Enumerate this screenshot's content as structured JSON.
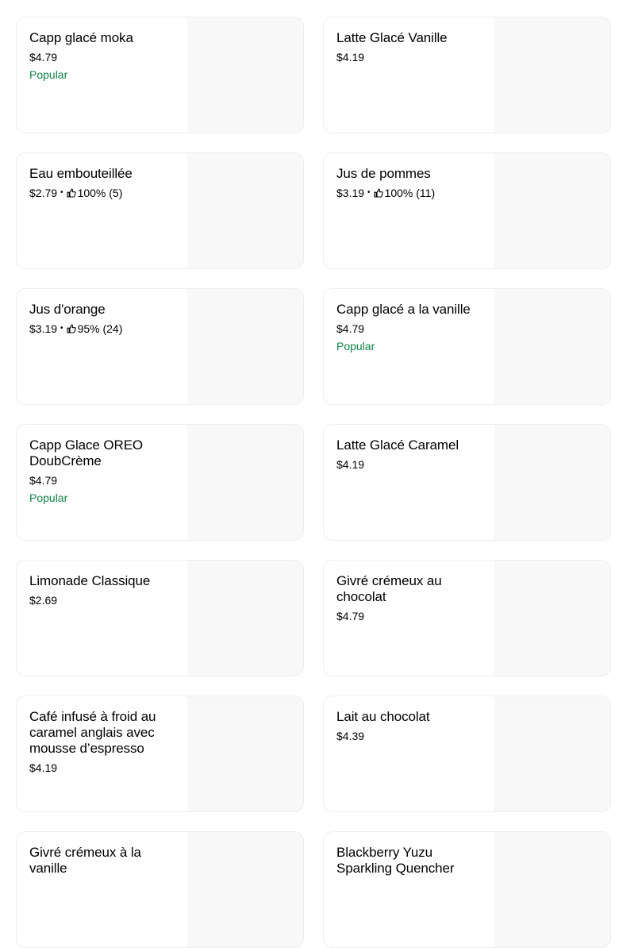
{
  "menu": {
    "items": [
      {
        "name": "Capp glacé moka",
        "price": "$4.79",
        "badge": "Popular"
      },
      {
        "name": "Latte Glacé Vanille",
        "price": "$4.19"
      },
      {
        "name": "Eau embouteillée",
        "price": "$2.79",
        "rating": "100% (5)"
      },
      {
        "name": "Jus de pommes",
        "price": "$3.19",
        "rating": "100% (11)"
      },
      {
        "name": "Jus d'orange",
        "price": "$3.19",
        "rating": "95% (24)"
      },
      {
        "name": "Capp glacé a la vanille",
        "price": "$4.79",
        "badge": "Popular"
      },
      {
        "name": "Capp Glace OREO DoubCrème",
        "price": "$4.79",
        "badge": "Popular"
      },
      {
        "name": "Latte Glacé Caramel",
        "price": "$4.19"
      },
      {
        "name": "Limonade Classique",
        "price": "$2.69"
      },
      {
        "name": "Givré crémeux au chocolat",
        "price": "$4.79"
      },
      {
        "name": "Café infusé à froid au caramel anglais avec mousse d’espresso",
        "price": "$4.19"
      },
      {
        "name": "Lait au chocolat",
        "price": "$4.39"
      },
      {
        "name": "Givré crémeux à la vanille",
        "price": ""
      },
      {
        "name": "Blackberry Yuzu Sparkling Quencher",
        "price": ""
      }
    ]
  },
  "colors": {
    "badge": "#0e8345",
    "image_placeholder": "#f8f8f8",
    "card_border": "#eeeeee"
  },
  "icons": {
    "rating": "thumbs-up-icon"
  }
}
